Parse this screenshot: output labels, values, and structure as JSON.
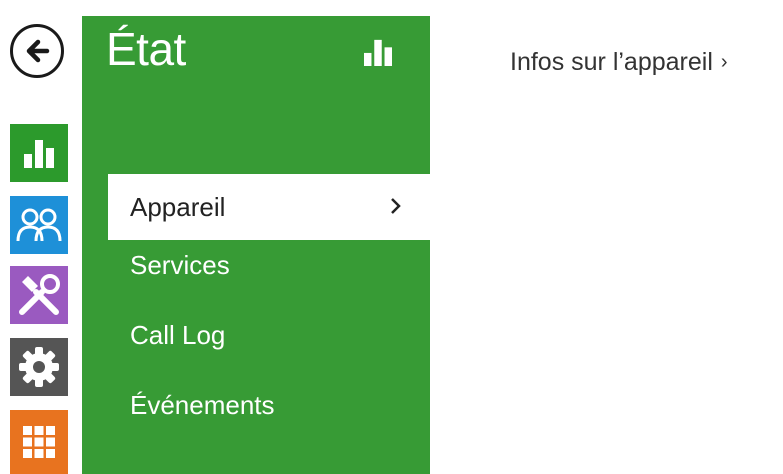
{
  "rail": {
    "back_icon": "arrow-left-circle-icon",
    "items": [
      {
        "icon": "bar-chart-icon",
        "color": "#2c9a2c"
      },
      {
        "icon": "users-icon",
        "color": "#1e90d8"
      },
      {
        "icon": "tools-icon",
        "color": "#9a5ac0"
      },
      {
        "icon": "gear-icon",
        "color": "#555555"
      },
      {
        "icon": "grid-icon",
        "color": "#e8731f"
      }
    ]
  },
  "panel": {
    "title": "État",
    "title_icon": "bar-chart-icon",
    "color": "#379b35",
    "items": [
      {
        "label": "Appareil",
        "active": true
      },
      {
        "label": "Services"
      },
      {
        "label": "Call Log"
      },
      {
        "label": "Événements"
      }
    ]
  },
  "content": {
    "device_info_link": "Infos sur l’appareil",
    "chevron": "›"
  }
}
